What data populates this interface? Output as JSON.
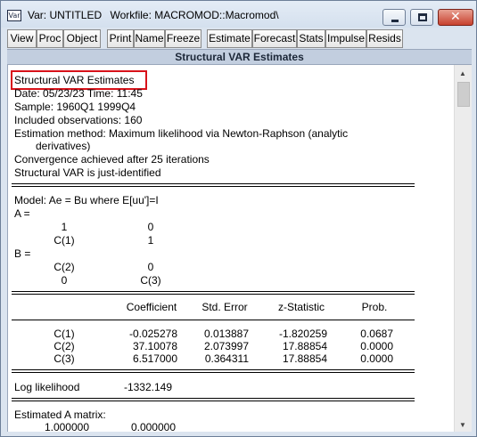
{
  "window": {
    "icon_text": "Var",
    "title": "Var: UNTITLED",
    "workfile": "Workfile: MACROMOD::Macromod\\",
    "minimize_label": "",
    "maximize_label": "",
    "close_label": "✕"
  },
  "toolbar": {
    "buttons": [
      "View",
      "Proc",
      "Object",
      "Print",
      "Name",
      "Freeze",
      "Estimate",
      "Forecast",
      "Stats",
      "Impulse",
      "Resids"
    ]
  },
  "view_title": "Structural VAR Estimates",
  "header": {
    "title": "Structural VAR Estimates",
    "date": "Date: 05/23/23   Time: 11:45",
    "sample": "Sample: 1960Q1 1999Q4",
    "observations": "Included observations: 160",
    "method_line1": "Estimation method: Maximum likelihood via Newton-Raphson (analytic",
    "method_line2": "derivatives)",
    "convergence": "Convergence achieved after 25 iterations",
    "identification": "Structural VAR is just-identified"
  },
  "model": {
    "equation": "Model: Ae = Bu where E[uu']=I",
    "a_label": "A =",
    "a_rows": [
      [
        "1",
        "0"
      ],
      [
        "C(1)",
        "1"
      ]
    ],
    "b_label": "B =",
    "b_rows": [
      [
        "C(2)",
        "0"
      ],
      [
        "0",
        "C(3)"
      ]
    ]
  },
  "coef_table": {
    "headers": [
      "Coefficient",
      "Std. Error",
      "z-Statistic",
      "Prob."
    ],
    "rows": [
      {
        "name": "C(1)",
        "coef": "-0.025278",
        "se": "0.013887",
        "z": "-1.820259",
        "p": "0.0687"
      },
      {
        "name": "C(2)",
        "coef": "37.10078",
        "se": "2.073997",
        "z": "17.88854",
        "p": "0.0000"
      },
      {
        "name": "C(3)",
        "coef": "6.517000",
        "se": "0.364311",
        "z": "17.88854",
        "p": "0.0000"
      }
    ]
  },
  "loglik": {
    "label": "Log likelihood",
    "value": "-1332.149"
  },
  "estimated_a": {
    "label": "Estimated A matrix:",
    "first_row": [
      "1.000000",
      "0.000000"
    ]
  }
}
